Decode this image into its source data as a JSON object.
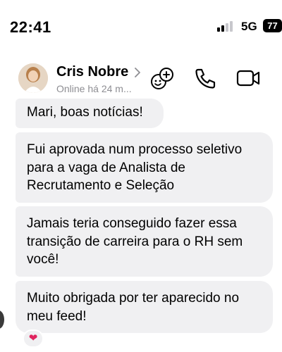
{
  "status_bar": {
    "time": "22:41",
    "network": "5G",
    "battery": "77"
  },
  "header": {
    "contact_name": "Cris Nobre",
    "presence": "Online há 24 m..."
  },
  "messages": [
    {
      "lines": [
        "Mari, boas notícias!"
      ]
    },
    {
      "lines": [
        "Fui aprovada num processo seletivo",
        "para a vaga de Analista de",
        "Recrutamento e Seleção"
      ]
    },
    {
      "lines": [
        "Jamais teria conseguido fazer essa",
        "transição de carreira para o RH sem",
        "você!"
      ]
    },
    {
      "lines": [
        "Muito obrigada por ter aparecido no",
        "meu feed!"
      ]
    }
  ],
  "reaction": {
    "emoji": "❤"
  },
  "colors": {
    "bubble": "#f0f0f2",
    "secondary_text": "#8e8e93",
    "reaction_heart": "#e0245e"
  }
}
